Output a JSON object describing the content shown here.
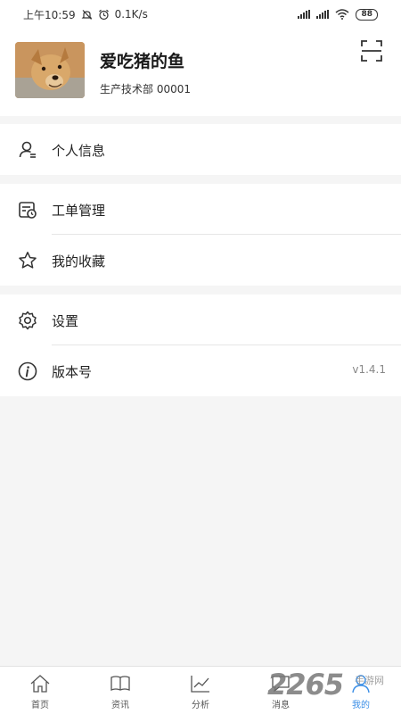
{
  "status_bar": {
    "time": "上午10:59",
    "speed": "0.1K/s",
    "battery": "88"
  },
  "profile": {
    "name": "爱吃猪的鱼",
    "department": "生产技术部 00001"
  },
  "menu": {
    "personal_info": "个人信息",
    "work_orders": "工单管理",
    "favorites": "我的收藏",
    "settings": "设置",
    "version_label": "版本号",
    "version_value": "v1.4.1"
  },
  "tabs": [
    {
      "label": "首页",
      "icon": "home-icon"
    },
    {
      "label": "资讯",
      "icon": "book-icon"
    },
    {
      "label": "分析",
      "icon": "chart-icon"
    },
    {
      "label": "消息",
      "icon": "message-icon"
    },
    {
      "label": "我的",
      "icon": "user-icon"
    }
  ],
  "active_tab": "我的",
  "watermark": {
    "number": "2265",
    "text": "手游网"
  },
  "colors": {
    "accent": "#3a8ee6",
    "background": "#f5f5f5"
  }
}
